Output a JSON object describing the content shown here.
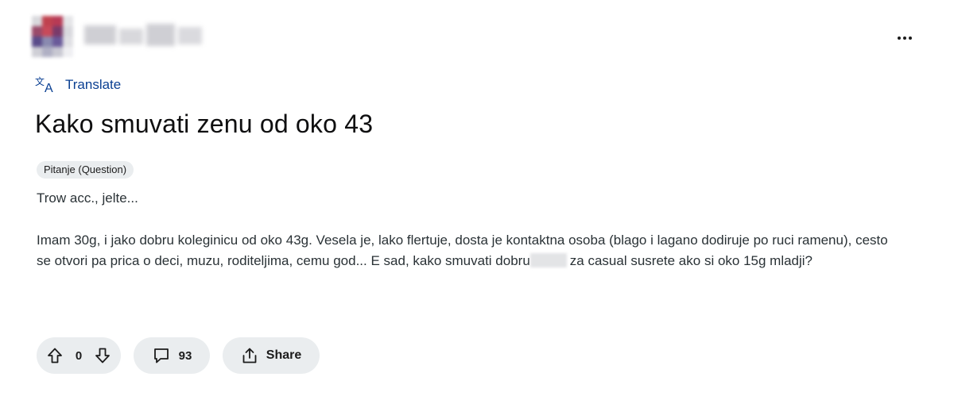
{
  "post": {
    "translate_label": "Translate",
    "title": "Kako smuvati zenu od oko 43",
    "flair": "Pitanje (Question)",
    "text_line1": "Trow acc., jelte...",
    "body_part1": "Imam 30g, i jako dobru koleginicu od oko 43g. Vesela je, lako flertuje, dosta je kontaktna osoba (blago i lagano dodiruje po ruci ramenu), cesto se otvori pa prica o deci, muzu, roditeljima, cemu god... E sad, kako smuvati dobru",
    "body_part2": "za casual susrete ako si oko 15g mladji?"
  },
  "actions": {
    "vote_count": "0",
    "comment_count": "93",
    "share_label": "Share"
  },
  "icons": {
    "avatar": "avatar-blurred",
    "translate": "translate-icon",
    "more": "ellipsis-icon",
    "upvote": "upvote-arrow-icon",
    "downvote": "downvote-arrow-icon",
    "comment": "comment-bubble-icon",
    "share": "share-icon"
  },
  "colors": {
    "link": "#0a3f92",
    "pill_bg": "#eaedef",
    "text": "#1c1c1c"
  }
}
